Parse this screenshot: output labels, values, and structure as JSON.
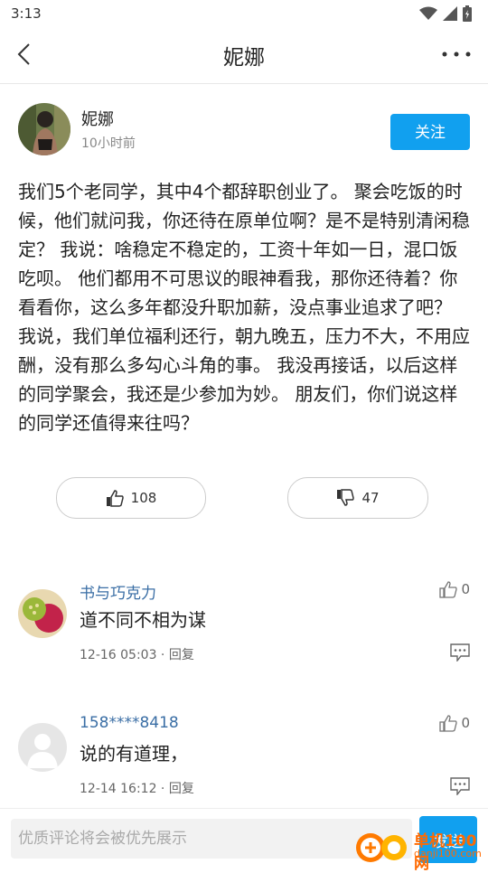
{
  "status": {
    "time": "3:13"
  },
  "nav": {
    "title": "妮娜"
  },
  "post": {
    "author": "妮娜",
    "time": "10小时前",
    "follow_label": "关注",
    "content": "我们5个老同学，其中4个都辞职创业了。 聚会吃饭的时候，他们就问我，你还待在原单位啊？是不是特别清闲稳定？ 我说：啥稳定不稳定的，工资十年如一日，混口饭吃呗。 他们都用不可思议的眼神看我，那你还待着？你看看你，这么多年都没升职加薪，没点事业追求了吧？ 我说，我们单位福利还行，朝九晚五，压力不大，不用应酬，没有那么多勾心斗角的事。 我没再接话，以后这样的同学聚会，我还是少参加为妙。 朋友们，你们说这样的同学还值得来往吗？",
    "likes": "108",
    "dislikes": "47"
  },
  "comments": [
    {
      "name": "书与巧克力",
      "text": "道不同不相为谋",
      "date": "12-16 05:03",
      "reply_label": "回复",
      "likes": "0"
    },
    {
      "name": "158****8418",
      "text": "说的有道理，",
      "date": "12-14 16:12",
      "reply_label": "回复",
      "likes": "0"
    }
  ],
  "bottom": {
    "placeholder": "优质评论将会被优先展示",
    "send_label": "发送"
  },
  "watermark": {
    "text": "单机100网",
    "sub": "danji100.com"
  },
  "colors": {
    "accent": "#11a0ef",
    "name_blue": "#3a6ea5"
  }
}
